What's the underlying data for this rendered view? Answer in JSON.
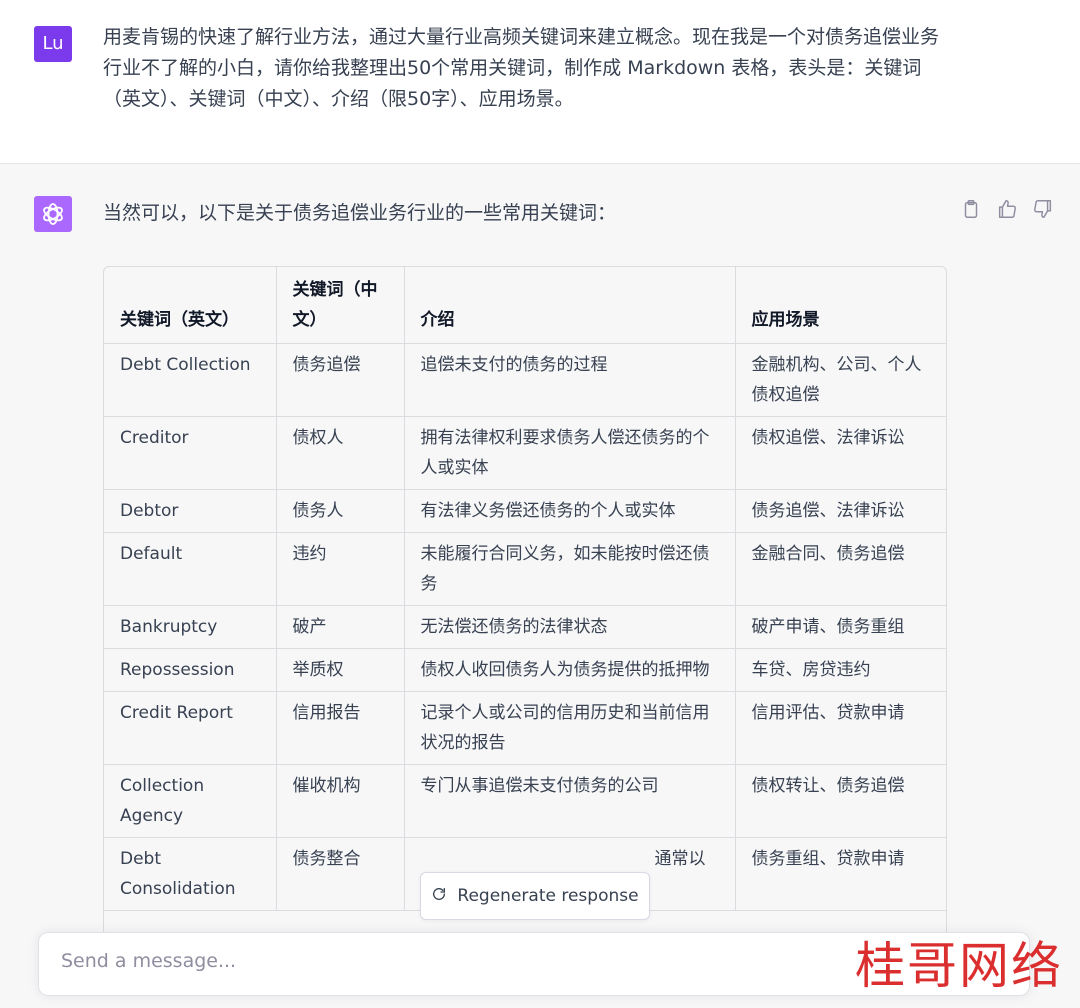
{
  "user_message": {
    "avatar": "Lu",
    "text": "用麦肯锡的快速了解行业方法，通过大量行业高频关键词来建立概念。现在我是一个对债务追偿业务行业不了解的小白，请你给我整理出50个常用关键词，制作成 Markdown 表格，表头是：关键词（英文）、关键词（中文）、介绍（限50字）、应用场景。"
  },
  "assistant": {
    "intro": "当然可以，以下是关于债务追偿业务行业的一些常用关键词：",
    "actions": [
      "clipboard-icon",
      "thumbs-up-icon",
      "thumbs-down-icon"
    ]
  },
  "table": {
    "headers": [
      "关键词（英文）",
      "关键词（中文）",
      "介绍",
      "应用场景"
    ],
    "rows": [
      [
        "Debt Collection",
        "债务追偿",
        "追偿未支付的债务的过程",
        "金融机构、公司、个人债权追偿"
      ],
      [
        "Creditor",
        "债权人",
        "拥有法律权利要求债务人偿还债务的个人或实体",
        "债权追偿、法律诉讼"
      ],
      [
        "Debtor",
        "债务人",
        "有法律义务偿还债务的个人或实体",
        "债务追偿、法律诉讼"
      ],
      [
        "Default",
        "违约",
        "未能履行合同义务，如未能按时偿还债务",
        "金融合同、债务追偿"
      ],
      [
        "Bankruptcy",
        "破产",
        "无法偿还债务的法律状态",
        "破产申请、债务重组"
      ],
      [
        "Repossession",
        "举质权",
        "债权人收回债务人为债务提供的抵押物",
        "车贷、房贷违约"
      ],
      [
        "Credit Report",
        "信用报告",
        "记录个人或公司的信用历史和当前信用状况的报告",
        "信用评估、贷款申请"
      ],
      [
        "Collection Agency",
        "催收机构",
        "专门从事追偿未支付债务的公司",
        "债权转让、债务追偿"
      ],
      [
        "Debt Consolidation",
        "债务整合",
        "通常以",
        "债务重组、贷款申请"
      ]
    ]
  },
  "regenerate_label": "Regenerate response",
  "input_placeholder": "Send a message...",
  "watermark": "桂哥网络"
}
